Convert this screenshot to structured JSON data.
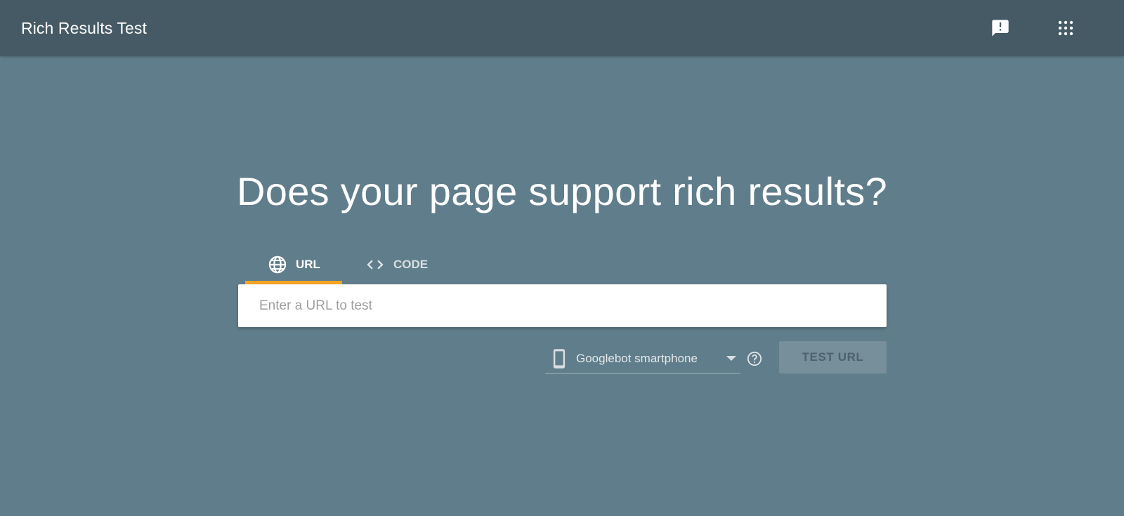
{
  "header": {
    "title": "Rich Results Test",
    "icons": {
      "feedback": "feedback-icon",
      "apps": "apps-grid-icon"
    }
  },
  "main": {
    "headline": "Does your page support rich results?",
    "tabs": [
      {
        "label": "URL",
        "icon": "globe-icon",
        "active": true
      },
      {
        "label": "CODE",
        "icon": "code-brackets-icon",
        "active": false
      }
    ],
    "url_input": {
      "placeholder": "Enter a URL to test",
      "value": ""
    },
    "crawler_select": {
      "selected": "Googlebot smartphone",
      "icon": "smartphone-icon"
    },
    "help_icon": "help-circle-icon",
    "test_button": {
      "label": "TEST URL",
      "enabled": false
    }
  },
  "colors": {
    "background": "#607d8b",
    "header": "#455a64",
    "tab_indicator": "#f4a424"
  }
}
